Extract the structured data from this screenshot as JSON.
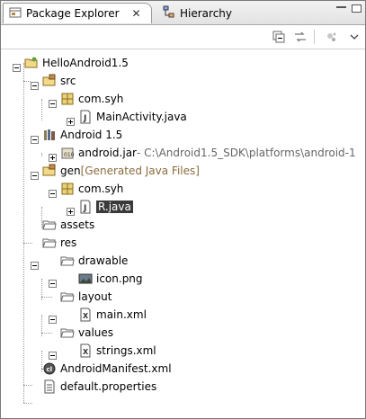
{
  "tabs": [
    {
      "label": "Package Explorer",
      "close": "✕"
    },
    {
      "label": "Hierarchy"
    }
  ],
  "tree": [
    {
      "label": "HelloAndroid1.5"
    },
    {
      "label": "src"
    },
    {
      "label": "com.syh"
    },
    {
      "label": "MainActivity.java"
    },
    {
      "label": "Android 1.5"
    },
    {
      "label": "android.jar",
      "deco": " - C:\\Android1.5_SDK\\platforms\\android-1"
    },
    {
      "label": "gen",
      "deco": " [Generated Java Files]"
    },
    {
      "label": "com.syh"
    },
    {
      "label": "R.java"
    },
    {
      "label": "assets"
    },
    {
      "label": "res"
    },
    {
      "label": "drawable"
    },
    {
      "label": "icon.png"
    },
    {
      "label": "layout"
    },
    {
      "label": "main.xml"
    },
    {
      "label": "values"
    },
    {
      "label": "strings.xml"
    },
    {
      "label": "AndroidManifest.xml"
    },
    {
      "label": "default.properties"
    }
  ]
}
